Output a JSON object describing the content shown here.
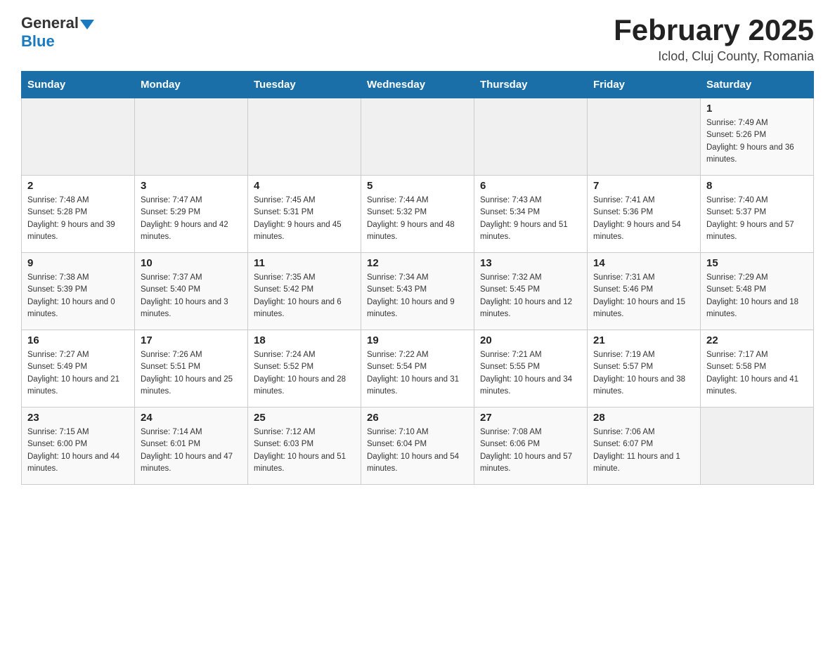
{
  "header": {
    "logo_text": "General",
    "logo_blue": "Blue",
    "month_title": "February 2025",
    "location": "Iclod, Cluj County, Romania"
  },
  "days_of_week": [
    "Sunday",
    "Monday",
    "Tuesday",
    "Wednesday",
    "Thursday",
    "Friday",
    "Saturday"
  ],
  "weeks": [
    [
      {
        "day": "",
        "info": ""
      },
      {
        "day": "",
        "info": ""
      },
      {
        "day": "",
        "info": ""
      },
      {
        "day": "",
        "info": ""
      },
      {
        "day": "",
        "info": ""
      },
      {
        "day": "",
        "info": ""
      },
      {
        "day": "1",
        "info": "Sunrise: 7:49 AM\nSunset: 5:26 PM\nDaylight: 9 hours and 36 minutes."
      }
    ],
    [
      {
        "day": "2",
        "info": "Sunrise: 7:48 AM\nSunset: 5:28 PM\nDaylight: 9 hours and 39 minutes."
      },
      {
        "day": "3",
        "info": "Sunrise: 7:47 AM\nSunset: 5:29 PM\nDaylight: 9 hours and 42 minutes."
      },
      {
        "day": "4",
        "info": "Sunrise: 7:45 AM\nSunset: 5:31 PM\nDaylight: 9 hours and 45 minutes."
      },
      {
        "day": "5",
        "info": "Sunrise: 7:44 AM\nSunset: 5:32 PM\nDaylight: 9 hours and 48 minutes."
      },
      {
        "day": "6",
        "info": "Sunrise: 7:43 AM\nSunset: 5:34 PM\nDaylight: 9 hours and 51 minutes."
      },
      {
        "day": "7",
        "info": "Sunrise: 7:41 AM\nSunset: 5:36 PM\nDaylight: 9 hours and 54 minutes."
      },
      {
        "day": "8",
        "info": "Sunrise: 7:40 AM\nSunset: 5:37 PM\nDaylight: 9 hours and 57 minutes."
      }
    ],
    [
      {
        "day": "9",
        "info": "Sunrise: 7:38 AM\nSunset: 5:39 PM\nDaylight: 10 hours and 0 minutes."
      },
      {
        "day": "10",
        "info": "Sunrise: 7:37 AM\nSunset: 5:40 PM\nDaylight: 10 hours and 3 minutes."
      },
      {
        "day": "11",
        "info": "Sunrise: 7:35 AM\nSunset: 5:42 PM\nDaylight: 10 hours and 6 minutes."
      },
      {
        "day": "12",
        "info": "Sunrise: 7:34 AM\nSunset: 5:43 PM\nDaylight: 10 hours and 9 minutes."
      },
      {
        "day": "13",
        "info": "Sunrise: 7:32 AM\nSunset: 5:45 PM\nDaylight: 10 hours and 12 minutes."
      },
      {
        "day": "14",
        "info": "Sunrise: 7:31 AM\nSunset: 5:46 PM\nDaylight: 10 hours and 15 minutes."
      },
      {
        "day": "15",
        "info": "Sunrise: 7:29 AM\nSunset: 5:48 PM\nDaylight: 10 hours and 18 minutes."
      }
    ],
    [
      {
        "day": "16",
        "info": "Sunrise: 7:27 AM\nSunset: 5:49 PM\nDaylight: 10 hours and 21 minutes."
      },
      {
        "day": "17",
        "info": "Sunrise: 7:26 AM\nSunset: 5:51 PM\nDaylight: 10 hours and 25 minutes."
      },
      {
        "day": "18",
        "info": "Sunrise: 7:24 AM\nSunset: 5:52 PM\nDaylight: 10 hours and 28 minutes."
      },
      {
        "day": "19",
        "info": "Sunrise: 7:22 AM\nSunset: 5:54 PM\nDaylight: 10 hours and 31 minutes."
      },
      {
        "day": "20",
        "info": "Sunrise: 7:21 AM\nSunset: 5:55 PM\nDaylight: 10 hours and 34 minutes."
      },
      {
        "day": "21",
        "info": "Sunrise: 7:19 AM\nSunset: 5:57 PM\nDaylight: 10 hours and 38 minutes."
      },
      {
        "day": "22",
        "info": "Sunrise: 7:17 AM\nSunset: 5:58 PM\nDaylight: 10 hours and 41 minutes."
      }
    ],
    [
      {
        "day": "23",
        "info": "Sunrise: 7:15 AM\nSunset: 6:00 PM\nDaylight: 10 hours and 44 minutes."
      },
      {
        "day": "24",
        "info": "Sunrise: 7:14 AM\nSunset: 6:01 PM\nDaylight: 10 hours and 47 minutes."
      },
      {
        "day": "25",
        "info": "Sunrise: 7:12 AM\nSunset: 6:03 PM\nDaylight: 10 hours and 51 minutes."
      },
      {
        "day": "26",
        "info": "Sunrise: 7:10 AM\nSunset: 6:04 PM\nDaylight: 10 hours and 54 minutes."
      },
      {
        "day": "27",
        "info": "Sunrise: 7:08 AM\nSunset: 6:06 PM\nDaylight: 10 hours and 57 minutes."
      },
      {
        "day": "28",
        "info": "Sunrise: 7:06 AM\nSunset: 6:07 PM\nDaylight: 11 hours and 1 minute."
      },
      {
        "day": "",
        "info": ""
      }
    ]
  ]
}
